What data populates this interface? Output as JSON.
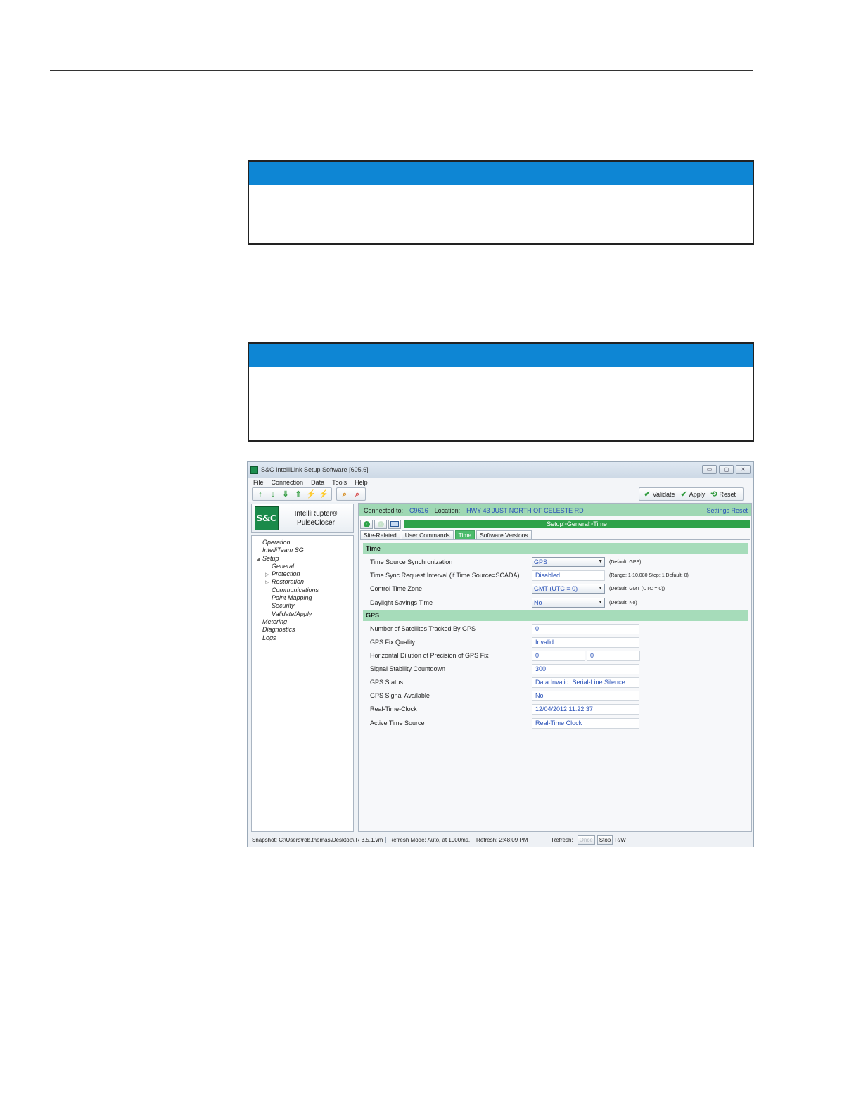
{
  "app": {
    "title": "S&C IntelliLink Setup Software [605.6]",
    "window_buttons": [
      "▭",
      "▢",
      "✕"
    ],
    "menu": [
      "File",
      "Connection",
      "Data",
      "Tools",
      "Help"
    ],
    "toolbar_actions": [
      "Validate",
      "Apply",
      "Reset"
    ],
    "product": {
      "logo": "S&C",
      "line1": "IntelliRupter®",
      "line2": "PulseCloser"
    },
    "tree": [
      {
        "label": "Operation",
        "level": 0,
        "arrow": ""
      },
      {
        "label": "IntelliTeam SG",
        "level": 0,
        "arrow": ""
      },
      {
        "label": "Setup",
        "level": 0,
        "arrow": "◢"
      },
      {
        "label": "General",
        "level": 1,
        "arrow": ""
      },
      {
        "label": "Protection",
        "level": 1,
        "arrow": "▷"
      },
      {
        "label": "Restoration",
        "level": 1,
        "arrow": "▷"
      },
      {
        "label": "Communications",
        "level": 1,
        "arrow": ""
      },
      {
        "label": "Point Mapping",
        "level": 1,
        "arrow": ""
      },
      {
        "label": "Security",
        "level": 1,
        "arrow": ""
      },
      {
        "label": "Validate/Apply",
        "level": 1,
        "arrow": ""
      },
      {
        "label": "Metering",
        "level": 0,
        "arrow": ""
      },
      {
        "label": "Diagnostics",
        "level": 0,
        "arrow": ""
      },
      {
        "label": "Logs",
        "level": 0,
        "arrow": ""
      }
    ],
    "connection": {
      "connected_label": "Connected to:",
      "connected_value": "C9616",
      "location_label": "Location:",
      "location_value": "HWY 43 JUST NORTH OF CELESTE RD",
      "settings_reset": "Settings Reset"
    },
    "path": "Setup>General>Time",
    "tabs": [
      "Site-Related",
      "User Commands",
      "Time",
      "Software Versions"
    ],
    "time_section": {
      "title": "Time",
      "source_sync": {
        "label": "Time Source Synchronization",
        "value": "GPS",
        "hint": "(Default: GPS)"
      },
      "sync_interval": {
        "label": "Time Sync Request Interval (if Time Source=SCADA)",
        "value": "Disabled",
        "hint": "(Range: 1-10,080 Step: 1 Default: 0)"
      },
      "time_zone": {
        "label": "Control Time Zone",
        "value": "GMT (UTC = 0)",
        "hint": "(Default: GMT (UTC = 0))"
      },
      "dst": {
        "label": "Daylight Savings Time",
        "value": "No",
        "hint": "(Default: No)"
      }
    },
    "gps_section": {
      "title": "GPS",
      "satellites": {
        "label": "Number of Satellites Tracked By GPS",
        "value": "0"
      },
      "fix_quality": {
        "label": "GPS Fix Quality",
        "value": "Invalid"
      },
      "hdop": {
        "label": "Horizontal Dilution of Precision of GPS Fix",
        "value1": "0",
        "value2": "0"
      },
      "countdown": {
        "label": "Signal Stability Countdown",
        "value": "300"
      },
      "status": {
        "label": "GPS Status",
        "value": "Data Invalid: Serial-Line Silence"
      },
      "signal": {
        "label": "GPS Signal Available",
        "value": "No"
      },
      "rtc": {
        "label": "Real-Time-Clock",
        "value": "12/04/2012 11:22:37"
      },
      "active_source": {
        "label": "Active Time Source",
        "value": "Real-Time Clock"
      }
    },
    "status_bar": {
      "snapshot": "Snapshot: C:\\Users\\rob.thomas\\Desktop\\IR 3.5.1.vm",
      "refresh_mode": "Refresh Mode: Auto, at 1000ms.",
      "refresh_time": "Refresh: 2:48:09 PM",
      "refresh_label": "Refresh:",
      "once": "Once",
      "stop": "Stop",
      "rw": "R/W"
    }
  },
  "colors": {
    "notice_bar": "#0e86d4",
    "accent_green": "#2ea24a",
    "section_green": "#a6dcba",
    "value_blue": "#2a52b8"
  }
}
